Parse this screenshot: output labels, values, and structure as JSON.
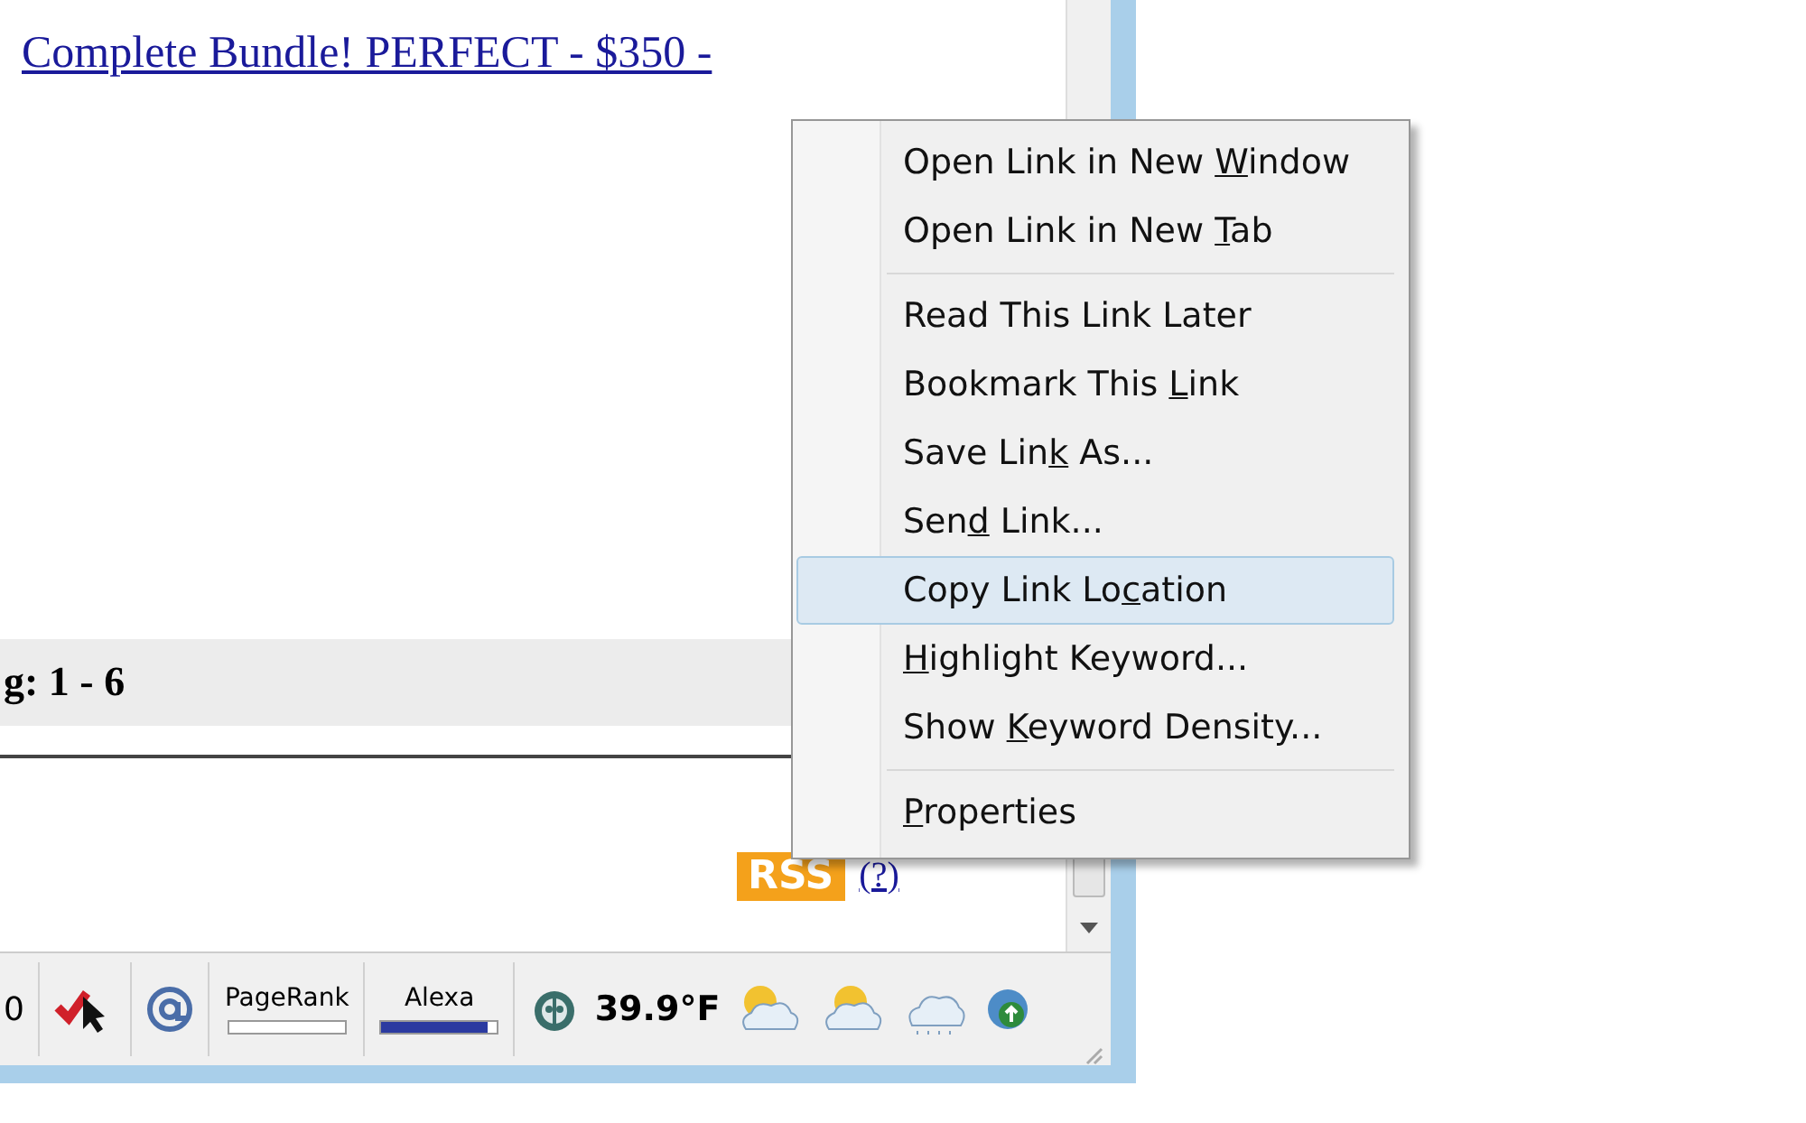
{
  "page": {
    "link": "Complete Bundle! PERFECT - $350 -",
    "band_text": "g: 1 - 6",
    "rss_badge": "RSS",
    "rss_help_link": "(?)"
  },
  "context_menu": {
    "groups": [
      [
        {
          "before": "Open Link in New ",
          "key": "W",
          "after": "indow",
          "selected": false
        },
        {
          "before": "Open Link in New ",
          "key": "T",
          "after": "ab",
          "selected": false
        }
      ],
      [
        {
          "before": "Read This Link Later",
          "selected": false
        },
        {
          "before": "Bookmark This ",
          "key": "L",
          "after": "ink",
          "selected": false
        },
        {
          "before": "Save Lin",
          "key": "k",
          "after": " As...",
          "selected": false
        },
        {
          "before": "Sen",
          "key": "d",
          "after": " Link...",
          "selected": false
        },
        {
          "before": "Copy Link Lo",
          "key": "c",
          "after": "ation",
          "selected": true
        },
        {
          "key": "H",
          "after": "ighlight Keyword...",
          "selected": false
        },
        {
          "before": "Show ",
          "key": "K",
          "after": "eyword Density...",
          "selected": false
        }
      ],
      [
        {
          "key": "P",
          "after": "roperties",
          "selected": false
        }
      ]
    ]
  },
  "status_bar": {
    "cut_text": "0",
    "pagerank": {
      "label": "PageRank",
      "level": 0
    },
    "alexa": {
      "label": "Alexa",
      "level": 0.92
    },
    "temperature": "39.9°F"
  }
}
